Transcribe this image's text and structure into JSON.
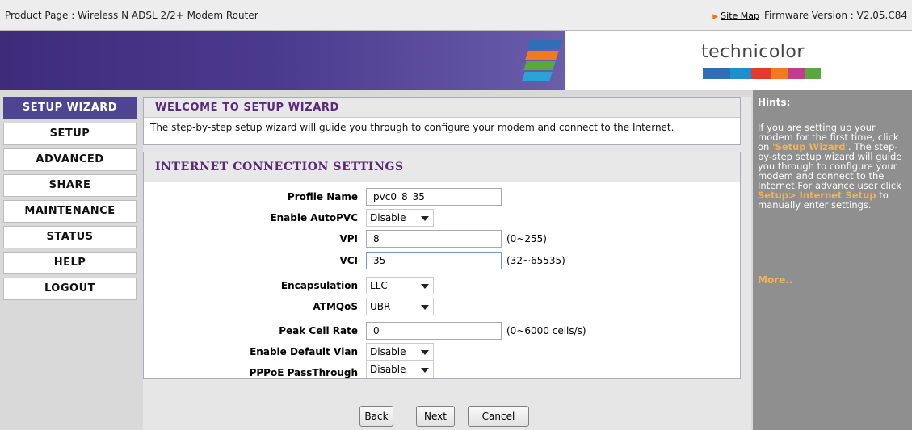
{
  "topbar": {
    "product_label": "Product Page : Wireless N ADSL 2/2+ Modem Router",
    "site_map": "Site Map",
    "firmware": "Firmware Version : V2.05.C84"
  },
  "brand": {
    "name": "technicolor"
  },
  "nav": {
    "items": [
      {
        "label": "SETUP WIZARD"
      },
      {
        "label": "SETUP"
      },
      {
        "label": "ADVANCED"
      },
      {
        "label": "SHARE"
      },
      {
        "label": "MAINTENANCE"
      },
      {
        "label": "STATUS"
      },
      {
        "label": "HELP"
      },
      {
        "label": "LOGOUT"
      }
    ]
  },
  "welcome": {
    "title": "WELCOME TO SETUP WIZARD",
    "text": "The step-by-step setup wizard will guide you through to configure your modem and connect to the Internet."
  },
  "settings": {
    "title": "INTERNET CONNECTION SETTINGS",
    "profile_name": {
      "label": "Profile Name",
      "value": "pvc0_8_35"
    },
    "autopvc": {
      "label": "Enable AutoPVC",
      "value": "Disable"
    },
    "vpi": {
      "label": "VPI",
      "value": "8",
      "range": "(0~255)"
    },
    "vci": {
      "label": "VCI",
      "value": "35",
      "range": "(32~65535)"
    },
    "encapsulation": {
      "label": "Encapsulation",
      "value": "LLC"
    },
    "atmqos": {
      "label": "ATMQoS",
      "value": "UBR"
    },
    "peak_cell_rate": {
      "label": "Peak Cell Rate",
      "value": "0",
      "range": "(0~6000 cells/s)"
    },
    "default_vlan": {
      "label": "Enable Default Vlan",
      "value": "Disable"
    },
    "pppoe": {
      "label": "PPPoE PassThrough",
      "value": "Disable"
    }
  },
  "buttons": {
    "back": "Back",
    "next": "Next",
    "cancel": "Cancel"
  },
  "hints": {
    "title": "Hints:",
    "t1": "If you are setting up your modem for the first time, click on ",
    "h1": "'Setup Wizard'",
    "t2": ". The step-by-step setup wizard will guide you through to configure your modem and connect to the Internet.For advance user click ",
    "h2": "Setup> Internet Setup",
    "t3": " to manually enter settings.",
    "more": "More.."
  },
  "colors": {
    "nav_active": "#4e4491",
    "header_text": "#5a2878",
    "hint_highlight": "#f3b25a",
    "hints_bg": "#8f8f8f"
  }
}
